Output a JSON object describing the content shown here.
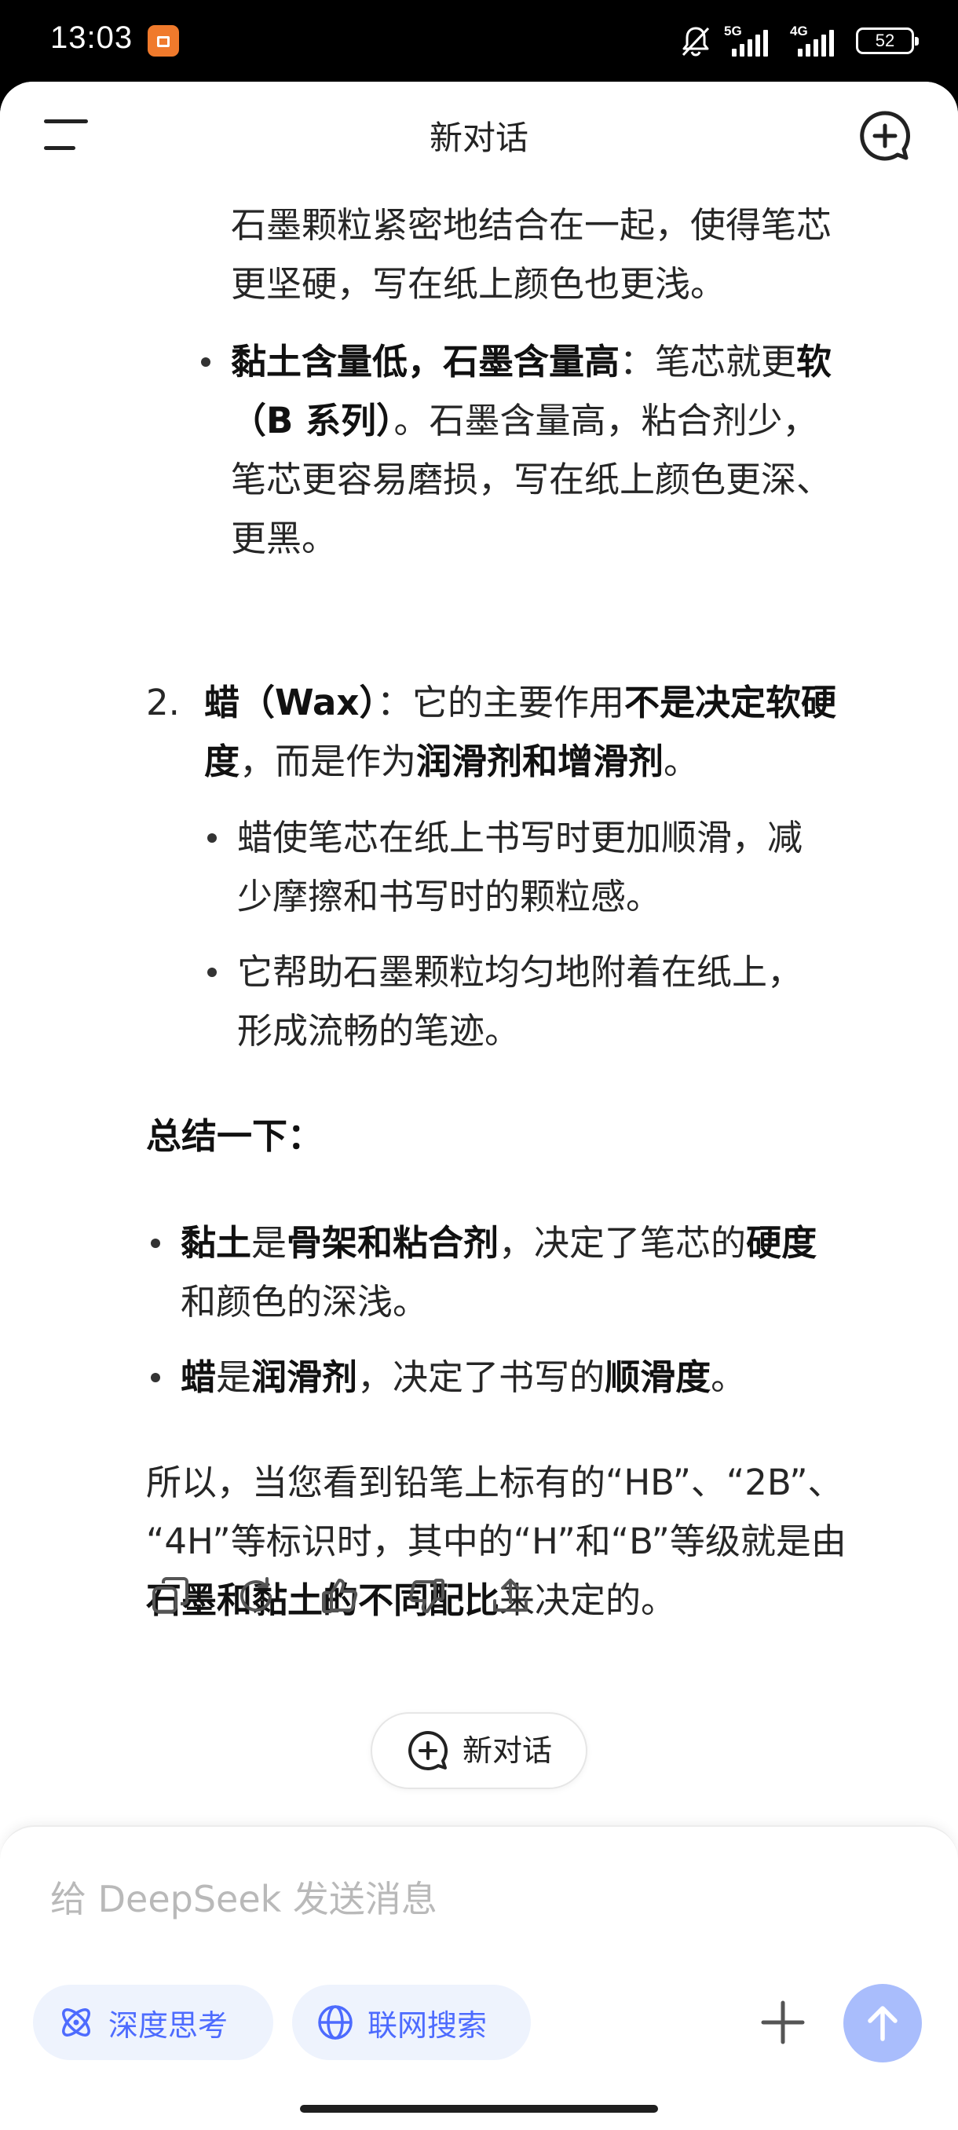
{
  "status_bar": {
    "time": "13:03",
    "network1": "5G",
    "network2": "4G",
    "battery": "52"
  },
  "header": {
    "title": "新对话"
  },
  "content": {
    "p1": {
      "l1": "石墨颗粒紧密地结合在一起，使得笔芯",
      "l2": "更坚硬，写在纸上颜色也更浅。"
    },
    "b1": {
      "bold1": "黏土含量低，石墨含量高",
      "t1": "：笔芯就更",
      "bold2": "软",
      "bold3": "（B 系列）",
      "t2": "。石墨含量高，粘合剂少，",
      "l3": "笔芯更容易磨损，写在纸上颜色更深、",
      "l4": "更黑。"
    },
    "n2": {
      "num": "2.",
      "bold1": "蜡（Wax）",
      "t1": "：它的主要作用",
      "bold2": "不是决定软硬",
      "bold3": "度",
      "t2": "，而是作为",
      "bold4": "润滑剂和增滑剂",
      "t3": "。"
    },
    "b2": {
      "l1": "蜡使笔芯在纸上书写时更加顺滑，减",
      "l2": "少摩擦和书写时的颗粒感。"
    },
    "b3": {
      "l1": "它帮助石墨颗粒均匀地附着在纸上，",
      "l2": "形成流畅的笔迹。"
    },
    "summary_heading": "总结一下：",
    "s1": {
      "bold1": "黏土",
      "t1": "是",
      "bold2": "骨架和粘合剂",
      "t2": "，决定了笔芯的",
      "bold3": "硬度",
      "l2": "和颜色的深浅。"
    },
    "s2": {
      "bold1": "蜡",
      "t1": "是",
      "bold2": "润滑剂",
      "t2": "，决定了书写的",
      "bold3": "顺滑度",
      "t3": "。"
    },
    "conclusion": {
      "l1": "所以，当您看到铅笔上标有的“HB”、“2B”、",
      "l2": "“4H”等标识时，其中的“H”和“B”等级就是由",
      "bold1": "石墨和黏土的不同配比",
      "t1": "来决定的。"
    }
  },
  "actions": {
    "icons": [
      "copy-icon",
      "regenerate-icon",
      "thumbs-up-icon",
      "thumbs-down-icon",
      "share-icon"
    ]
  },
  "new_chat_pill": {
    "label": "新对话"
  },
  "composer": {
    "placeholder": "给 DeepSeek 发送消息",
    "deep_think_label": "深度思考",
    "web_search_label": "联网搜索"
  },
  "colors": {
    "accent": "#4d6bfe",
    "chip_bg": "#eef3fd",
    "send_button": "#a9bdfc"
  }
}
